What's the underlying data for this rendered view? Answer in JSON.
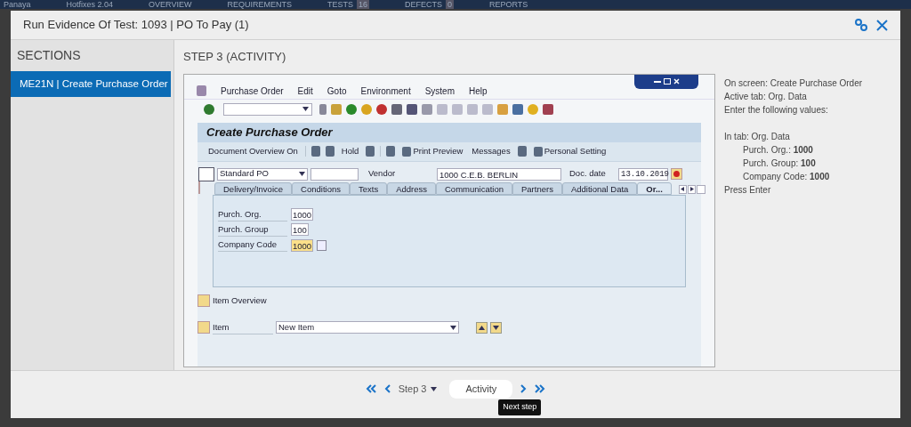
{
  "background_bar": {
    "logo": "Panaya",
    "items": [
      {
        "label": "Hotfixes 2.04"
      },
      {
        "label": "OVERVIEW"
      },
      {
        "label": "REQUIREMENTS"
      },
      {
        "label": "TESTS",
        "count": "16"
      },
      {
        "label": "DEFECTS",
        "count": "0"
      },
      {
        "label": "REPORTS"
      }
    ]
  },
  "modal": {
    "title": "Run Evidence Of Test: 1093 | PO To Pay (1)"
  },
  "sections": {
    "heading": "SECTIONS",
    "items": [
      {
        "label": "ME21N | Create Purchase Order",
        "selected": true
      }
    ]
  },
  "step_title": "STEP 3 (ACTIVITY)",
  "sap_screen": {
    "menu": [
      "Purchase Order",
      "Edit",
      "Goto",
      "Environment",
      "System",
      "Help"
    ],
    "screen_title": "Create Purchase Order",
    "app_toolbar": [
      {
        "kind": "text",
        "label": "Document Overview On"
      },
      {
        "kind": "sep"
      },
      {
        "kind": "icon"
      },
      {
        "kind": "icon"
      },
      {
        "kind": "text",
        "label": "Hold"
      },
      {
        "kind": "icon"
      },
      {
        "kind": "sep"
      },
      {
        "kind": "icon"
      },
      {
        "kind": "icon_text",
        "label": "Print Preview"
      },
      {
        "kind": "text",
        "label": "Messages"
      },
      {
        "kind": "icon"
      },
      {
        "kind": "icon_text",
        "label": "Personal Setting"
      }
    ],
    "order_type": "Standard PO",
    "vendor_label": "Vendor",
    "vendor_value": "1000 C.E.B. BERLIN",
    "doc_date_label": "Doc. date",
    "doc_date": "13.10.2019",
    "tabs": [
      {
        "label": "Delivery/Invoice",
        "selected": false
      },
      {
        "label": "Conditions",
        "selected": false
      },
      {
        "label": "Texts",
        "selected": false
      },
      {
        "label": "Address",
        "selected": false
      },
      {
        "label": "Communication",
        "selected": false
      },
      {
        "label": "Partners",
        "selected": false
      },
      {
        "label": "Additional Data",
        "selected": false
      },
      {
        "label": "Or...",
        "selected": true
      }
    ],
    "fields": [
      {
        "label": "Purch. Org.",
        "value": "1000",
        "focused": false
      },
      {
        "label": "Purch. Group",
        "value": "100",
        "focused": false
      },
      {
        "label": "Company Code",
        "value": "1000",
        "focused": true
      }
    ],
    "item_overview": "Item Overview",
    "item_label": "Item",
    "item_value": "New Item"
  },
  "instructions": [
    {
      "kind": "line",
      "text": "On screen: Create Purchase Order"
    },
    {
      "kind": "line",
      "text": "Active tab: Org. Data"
    },
    {
      "kind": "line",
      "text": "Enter the following values:"
    },
    {
      "kind": "blank"
    },
    {
      "kind": "line",
      "text": "In tab: Org. Data"
    },
    {
      "kind": "indent",
      "text": "Purch. Org.: **1000**"
    },
    {
      "kind": "indent",
      "text": "Purch. Group: **100**"
    },
    {
      "kind": "indent",
      "text": "Company Code: **1000**"
    },
    {
      "kind": "line",
      "text": "Press Enter"
    }
  ],
  "footer": {
    "step": "Step 3",
    "activity": "Activity",
    "tooltip": "Next step"
  }
}
